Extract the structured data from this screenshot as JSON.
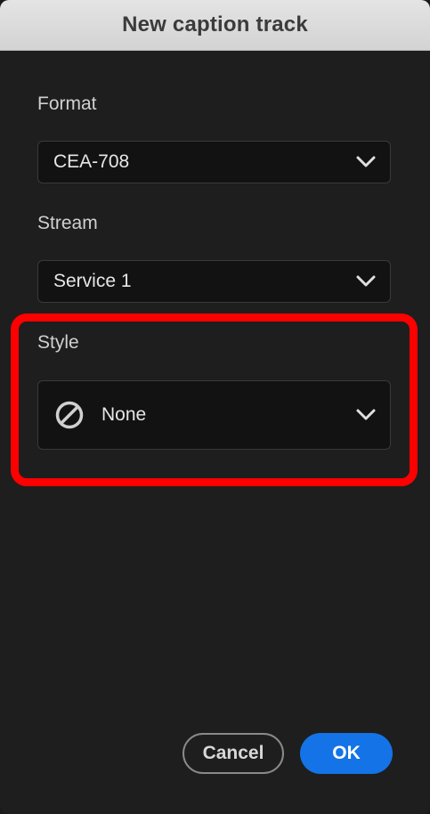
{
  "dialog": {
    "title": "New caption track"
  },
  "format": {
    "label": "Format",
    "value": "CEA-708"
  },
  "stream": {
    "label": "Stream",
    "value": "Service 1"
  },
  "style": {
    "label": "Style",
    "value": "None",
    "icon": "no-style-icon"
  },
  "buttons": {
    "cancel": "Cancel",
    "ok": "OK"
  },
  "colors": {
    "background": "#1e1e1e",
    "titlebar": "#dcdcdc",
    "accent": "#1473e6",
    "highlight": "#ff0000"
  }
}
